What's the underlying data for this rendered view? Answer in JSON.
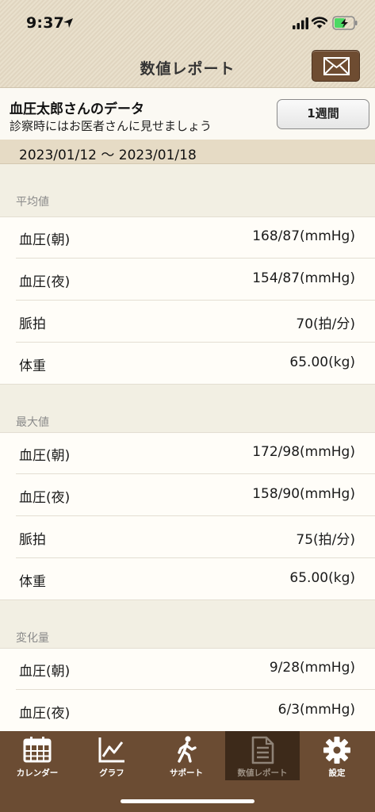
{
  "status_bar": {
    "time": "9:37"
  },
  "nav": {
    "title": "数値レポート",
    "mail_icon": "envelope-icon"
  },
  "header": {
    "title": "血圧太郎さんのデータ",
    "subtitle": "診察時にはお医者さんに見せましょう",
    "period_button": "1週間",
    "date_range": "2023/01/12 〜 2023/01/18"
  },
  "sections": [
    {
      "title": "平均値",
      "rows": [
        {
          "label": "血圧(朝)",
          "value": "168/87(mmHg)"
        },
        {
          "label": "血圧(夜)",
          "value": "154/87(mmHg)"
        },
        {
          "label": "脈拍",
          "value": "70(拍/分)"
        },
        {
          "label": "体重",
          "value": "65.00(kg)"
        }
      ]
    },
    {
      "title": "最大値",
      "rows": [
        {
          "label": "血圧(朝)",
          "value": "172/98(mmHg)"
        },
        {
          "label": "血圧(夜)",
          "value": "158/90(mmHg)"
        },
        {
          "label": "脈拍",
          "value": "75(拍/分)"
        },
        {
          "label": "体重",
          "value": "65.00(kg)"
        }
      ]
    },
    {
      "title": "変化量",
      "rows": [
        {
          "label": "血圧(朝)",
          "value": "9/28(mmHg)"
        },
        {
          "label": "血圧(夜)",
          "value": "6/3(mmHg)"
        }
      ]
    }
  ],
  "tabbar": {
    "items": [
      {
        "label": "カレンダー",
        "icon": "calendar-icon"
      },
      {
        "label": "グラフ",
        "icon": "chart-icon"
      },
      {
        "label": "サポート",
        "icon": "walking-person-icon"
      },
      {
        "label": "数値レポート",
        "icon": "document-icon",
        "active": true
      },
      {
        "label": "設定",
        "icon": "gear-icon"
      }
    ]
  },
  "colors": {
    "accent_brown": "#6b4c33",
    "active_tab": "#3d2a1a",
    "nav_beige": "#e7dcc6",
    "battery_green": "#4cd964"
  }
}
